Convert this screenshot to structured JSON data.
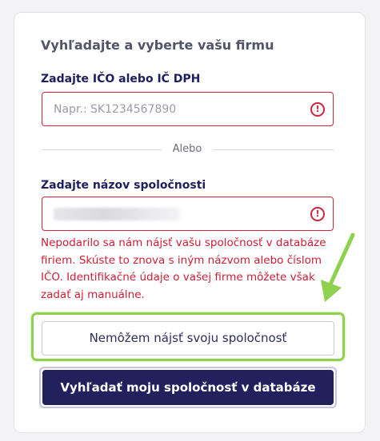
{
  "form": {
    "heading": "Vyhľadajte a vyberte vašu firmu",
    "ico_label": "Zadajte IČO alebo IČ DPH",
    "ico_placeholder": "Napr.: SK1234567890",
    "ico_value": "",
    "ico_error_glyph": "!",
    "divider_text": "Alebo",
    "name_label": "Zadajte názov spoločnosti",
    "name_error_glyph": "!",
    "error_message": "Nepodarilo sa nám nájsť vašu spoločnosť v databáze firiem. Skúste to znova s iným názvom alebo číslom IČO. Identifikačné údaje o vašej firme môžete však zadať aj manuálne.",
    "cant_find_button": "Nemôžem nájsť svoju spoločnosť",
    "search_button": "Vyhľadať moju spoločnosť v databáze"
  },
  "colors": {
    "primary": "#23205e",
    "error": "#d0243a",
    "highlight": "#8fd14f",
    "label": "#1f1e5e"
  }
}
